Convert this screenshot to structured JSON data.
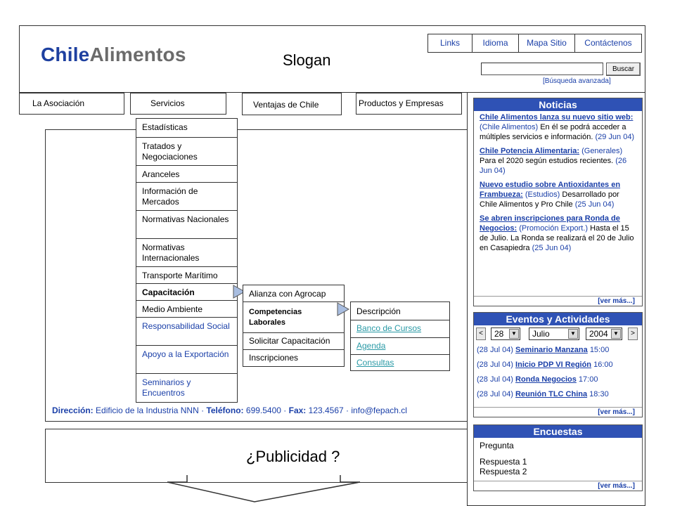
{
  "header": {
    "logo_part1": "Chile",
    "logo_part2": "Alimentos",
    "slogan": "Slogan",
    "top_links": [
      "Links",
      "Idioma",
      "Mapa Sitio",
      "Contáctenos"
    ],
    "search_placeholder": "",
    "search_button": "Buscar",
    "advanced_search": "[Búsqueda avanzada]"
  },
  "nav": {
    "tabs": [
      "La Asociación",
      "Servicios",
      "Ventajas de Chile",
      "Productos y Empresas"
    ]
  },
  "menu": {
    "items": [
      {
        "label": "Estadísticas"
      },
      {
        "label": "Tratados y Negociaciones"
      },
      {
        "label": "Aranceles"
      },
      {
        "label": "Información de Mercados"
      },
      {
        "label": "Normativas Nacionales"
      },
      {
        "label": "Normativas Internacionales"
      },
      {
        "label": "Transporte Marítimo"
      },
      {
        "label": "Capacitación"
      },
      {
        "label": "Medio Ambiente"
      },
      {
        "label": "Responsabilidad Social"
      },
      {
        "label": "Apoyo a la Exportación"
      },
      {
        "label": "Seminarios y Encuentros"
      }
    ],
    "sub1": [
      "Alianza con Agrocap",
      "Competencias Laborales",
      "Solicitar Capacitación",
      "Inscripciones"
    ],
    "sub2": [
      "Descripción",
      "Banco de Cursos",
      "Agenda",
      "Consultas"
    ]
  },
  "footer": {
    "address_label": "Dirección:",
    "address": "Edificio de la Industria NNN",
    "phone_label": "Teléfono:",
    "phone": "699.5400",
    "fax_label": "Fax:",
    "fax": "123.4567",
    "email": "info@fepach.cl"
  },
  "ad": {
    "text": "¿Publicidad ?"
  },
  "news": {
    "title": "Noticias",
    "items": [
      {
        "title": "Chile Alimentos lanza su nuevo sitio web:",
        "category": "(Chile Alimentos)",
        "text": "En él se podrá acceder a múltiples servicios e información.",
        "date": "(29 Jun 04)"
      },
      {
        "title": "Chile Potencia Alimentaria:",
        "category": "(Generales)",
        "text": "Para el 2020 según estudios recientes.",
        "date": "(26 Jun 04)"
      },
      {
        "title": "Nuevo estudio sobre Antioxidantes en Frambueza:",
        "category": "(Estudios)",
        "text": "Desarrollado por Chile Alimentos y Pro Chile",
        "date": "(25 Jun 04)"
      },
      {
        "title": "Se abren inscripciones para Ronda de Negocios:",
        "category": "(Promoción Export.)",
        "text": "Hasta el 15 de Julio. La Ronda se realizará el 20 de Julio en Casapiedra",
        "date": "(25 Jun 04)"
      }
    ],
    "more": "[ver más...]"
  },
  "events": {
    "title": "Eventos y Actividades",
    "prev": "<",
    "next": ">",
    "day": "28",
    "month": "Julio",
    "year": "2004",
    "items": [
      {
        "date": "(28 Jul 04)",
        "name": "Seminario Manzana",
        "time": "15:00"
      },
      {
        "date": "(28 Jul 04)",
        "name": "Inicio PDP VI Región",
        "time": "16:00"
      },
      {
        "date": "(28 Jul 04)",
        "name": "Ronda Negocios",
        "time": "17:00"
      },
      {
        "date": "(28 Jul 04)",
        "name": "Reunión TLC China",
        "time": "18:30"
      }
    ],
    "more": "[ver más...]"
  },
  "survey": {
    "title": "Encuestas",
    "question": "Pregunta",
    "answers": [
      "Respuesta 1",
      "Respuesta 2"
    ],
    "more": "[ver más...]"
  }
}
